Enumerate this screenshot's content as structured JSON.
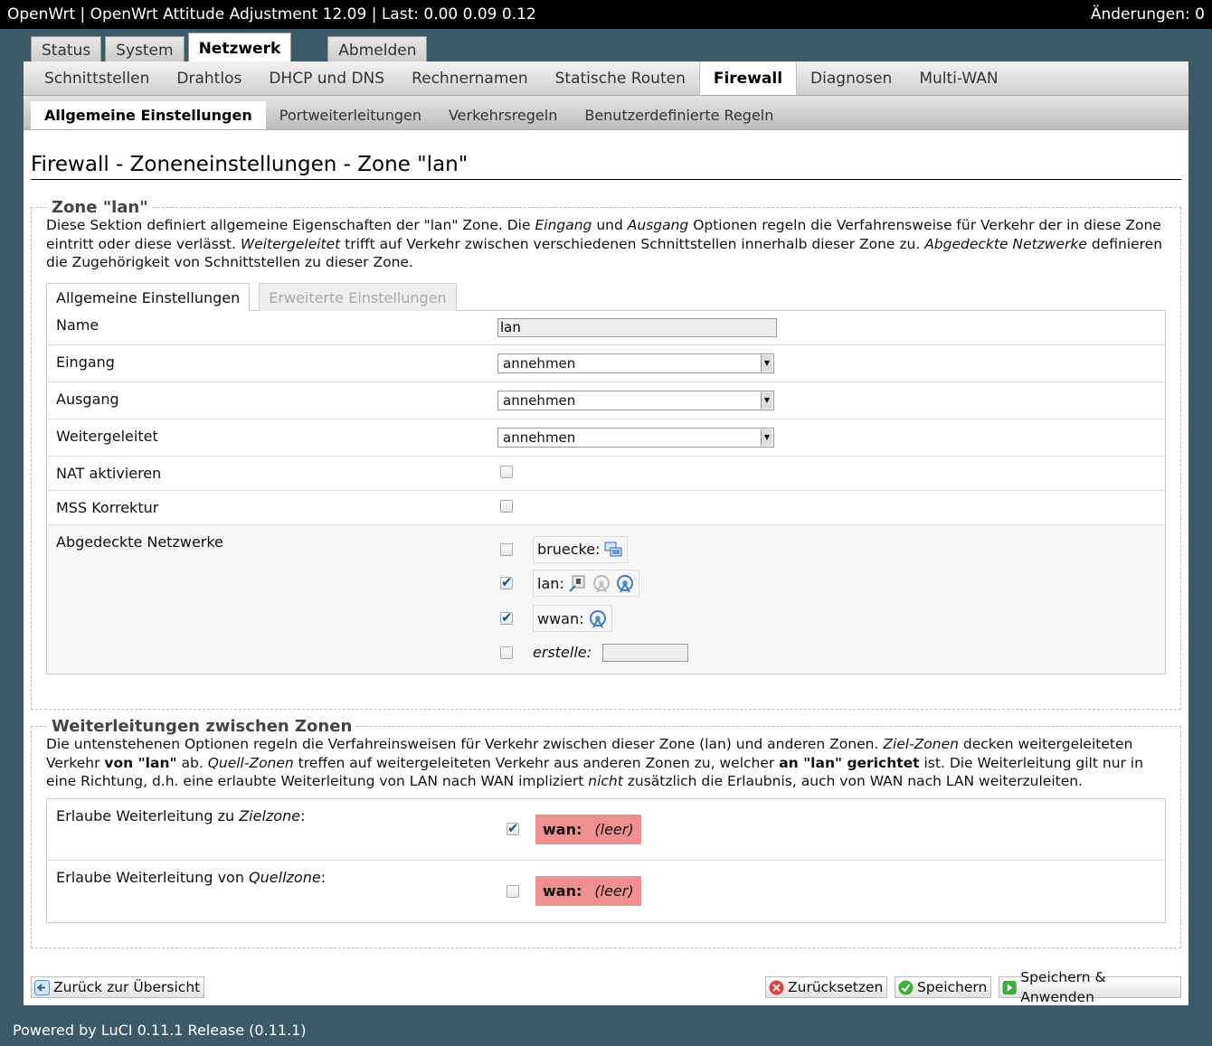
{
  "topbar": {
    "title": "OpenWrt | OpenWrt Attitude Adjustment 12.09 | Last: 0.00 0.09 0.12",
    "changes": "Änderungen: 0"
  },
  "main_tabs": [
    "Status",
    "System",
    "Netzwerk",
    "Abmelden"
  ],
  "main_tab_active": "Netzwerk",
  "sub_tabs": [
    "Schnittstellen",
    "Drahtlos",
    "DHCP und DNS",
    "Rechnernamen",
    "Statische Routen",
    "Firewall",
    "Diagnosen",
    "Multi-WAN"
  ],
  "sub_tab_active": "Firewall",
  "subsub_tabs": [
    "Allgemeine Einstellungen",
    "Portweiterleitungen",
    "Verkehrsregeln",
    "Benutzerdefinierte Regeln"
  ],
  "page_title": "Firewall - Zoneneinstellungen - Zone \"lan\"",
  "zone_section": {
    "legend": "Zone \"lan\"",
    "desc": {
      "p1": "Diese Sektion definiert allgemeine Eigenschaften der \"lan\" Zone. Die ",
      "i1": "Eingang",
      "p2": " und ",
      "i2": "Ausgang",
      "p3": " Optionen regeln die Verfahrensweise für Verkehr der in diese Zone eintritt oder diese verlässt. ",
      "i3": "Weitergeleitet",
      "p4": " trifft auf Verkehr zwischen verschiedenen Schnittstellen innerhalb dieser Zone zu. ",
      "i4": "Abgedeckte Netzwerke",
      "p5": " definieren die Zugehörigkeit von Schnittstellen zu dieser Zone."
    },
    "tab_general": "Allgemeine Einstellungen",
    "tab_advanced": "Erweiterte Einstellungen",
    "name_label": "Name",
    "name_value": "lan",
    "input_label": "Eingang",
    "input_value": "annehmen",
    "output_label": "Ausgang",
    "output_value": "annehmen",
    "forward_label": "Weitergeleitet",
    "forward_value": "annehmen",
    "nat_label": "NAT aktivieren",
    "mss_label": "MSS Korrektur",
    "networks_label": "Abgedeckte Netzwerke",
    "networks": [
      {
        "name": "bruecke:",
        "checked": false,
        "icons": [
          "bridge-icon"
        ]
      },
      {
        "name": "lan:",
        "checked": true,
        "icons": [
          "ethernet-icon",
          "wifi-disabled-icon",
          "wifi-icon"
        ]
      },
      {
        "name": "wwan:",
        "checked": true,
        "icons": [
          "wifi-icon"
        ]
      }
    ],
    "create_label": "erstelle:"
  },
  "forward_section": {
    "legend": "Weiterleitungen zwischen Zonen",
    "desc": {
      "p1": "Die untenstehenen Optionen regeln die Verfahreinsweisen für Verkehr zwischen dieser Zone (lan) und anderen Zonen. ",
      "i1": "Ziel-Zonen",
      "p2": " decken weitergeleiteten Verkehr ",
      "b1": "von \"lan\"",
      "p3": " ab. ",
      "i2": "Quell-Zonen",
      "p4": " treffen auf weitergeleiteten Verkehr aus anderen Zonen zu, welcher ",
      "b2": "an \"lan\" gerichtet",
      "p5": " ist. Die Weiterleitung gilt nur in eine Richtung, d.h. eine erlaubte Weiterleitung von LAN nach WAN impliziert ",
      "i3": "nicht",
      "p6": " zusätzlich die Erlaubnis, auch von WAN nach LAN weiterzuleiten."
    },
    "dest_label_pre": "Erlaube Weiterleitung zu ",
    "dest_label_em": "Zielzone",
    "src_label_pre": "Erlaube Weiterleitung von ",
    "src_label_em": "Quellzone",
    "label_colon": ":",
    "zone_name": "wan:",
    "zone_empty": "(leer)"
  },
  "buttons": {
    "back": "Zurück zur Übersicht",
    "reset": "Zurücksetzen",
    "save": "Speichern",
    "save_apply": "Speichern & Anwenden"
  },
  "footer": "Powered by LuCI 0.11.1 Release (0.11.1)",
  "colors": {
    "topbar": "#000000",
    "background": "#3d5a6b",
    "zone_badge": "#f08f8f"
  }
}
